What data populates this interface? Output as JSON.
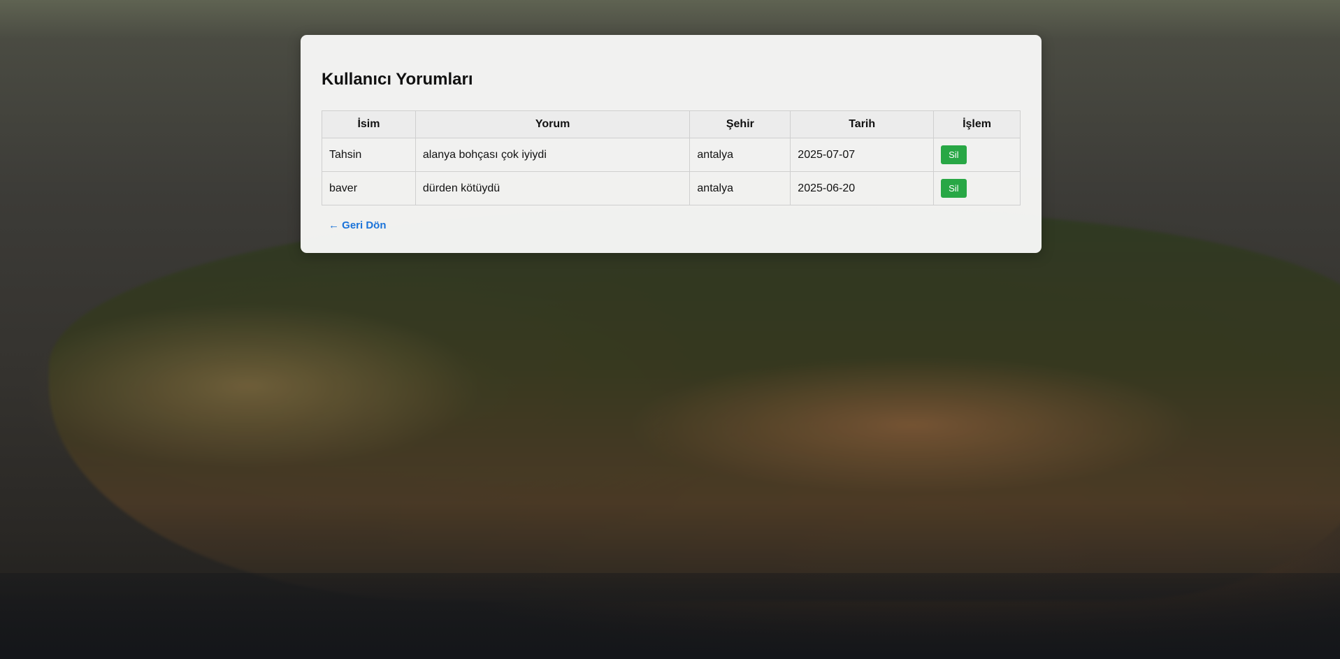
{
  "page": {
    "title": "Kullanıcı Yorumları"
  },
  "table": {
    "headers": {
      "name": "İsim",
      "comment": "Yorum",
      "city": "Şehir",
      "date": "Tarih",
      "action": "İşlem"
    },
    "rows": [
      {
        "name": "Tahsin",
        "comment": "alanya bohçası çok iyiydi",
        "city": "antalya",
        "date": "2025-07-07",
        "action_label": "Sil"
      },
      {
        "name": "baver",
        "comment": "dürden kötüydü",
        "city": "antalya",
        "date": "2025-06-20",
        "action_label": "Sil"
      }
    ]
  },
  "back_link": {
    "label": "← Geri Dön"
  },
  "colors": {
    "delete_button": "#28a745",
    "link": "#1a73d9"
  }
}
